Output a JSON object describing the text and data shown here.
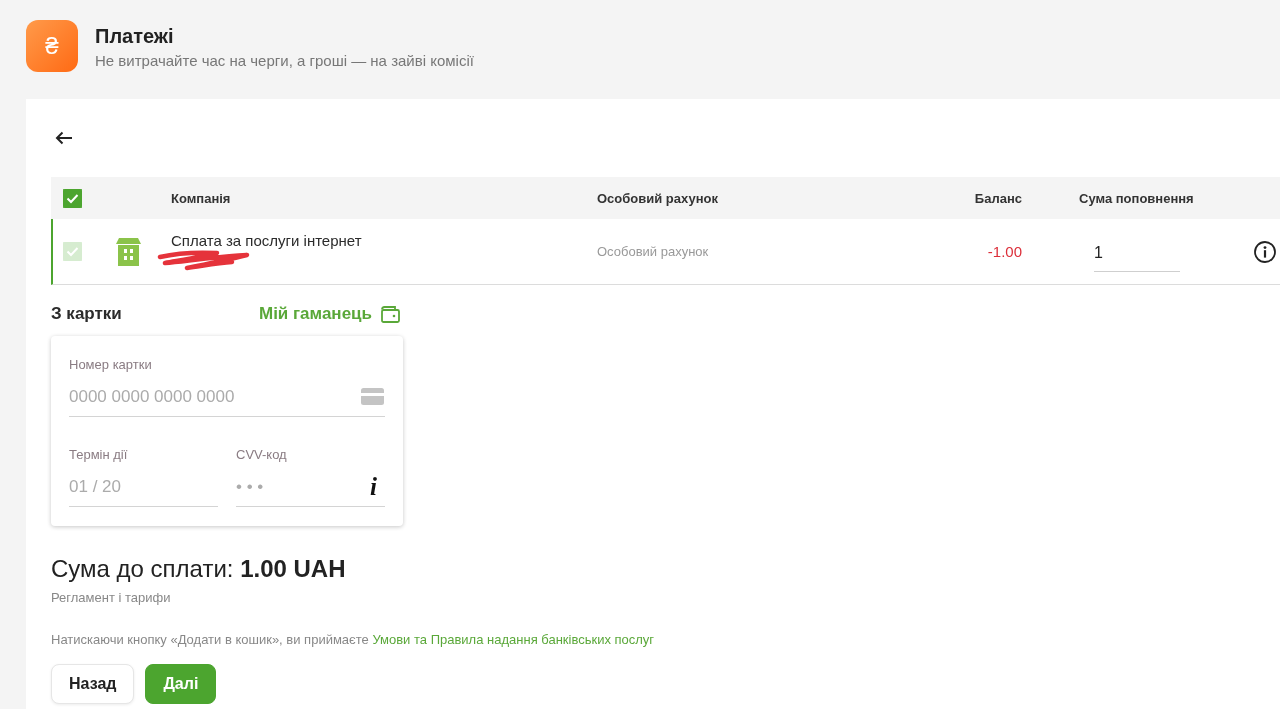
{
  "header": {
    "logo_symbol": "₴",
    "title": "Платежі",
    "subtitle": "Не витрачайте час на черги, а гроші — на зайві комісії"
  },
  "table": {
    "select_all_checked": true,
    "columns": [
      "Компанія",
      "Особовий рахунок",
      "Баланс",
      "Сума поповнення"
    ],
    "rows": [
      {
        "checked": true,
        "disabled": true,
        "company": "Сплата за послуги інтернет",
        "account": "Особовий рахунок",
        "balance": "-1.00",
        "balance_negative": true,
        "amount": "1"
      }
    ]
  },
  "source": {
    "title": "З картки",
    "wallet_link": "Мій гаманець"
  },
  "card_form": {
    "rows": [
      [
        {
          "kind": "card_number",
          "label": "Номер картки",
          "placeholder": "0000 0000 0000 0000"
        }
      ],
      [
        {
          "kind": "expiry",
          "label": "Термін дії",
          "placeholder": "01 / 20"
        },
        {
          "kind": "cvv",
          "label": "CVV-код",
          "placeholder": "• • •",
          "hint": "i"
        }
      ]
    ]
  },
  "total": "Сума до сплати: **1.00 UAH**",
  "tariffs_link": "Регламент і тарифи",
  "terms": {
    "text": "Натискаючи кнопку «Додати в кошик», ви приймаєте",
    "link": "Умови та Правила надання банківських послуг"
  },
  "buttons": [
    {
      "label": "Назад",
      "kind": "secondary"
    },
    {
      "label": "Далі",
      "kind": "primary"
    }
  ]
}
